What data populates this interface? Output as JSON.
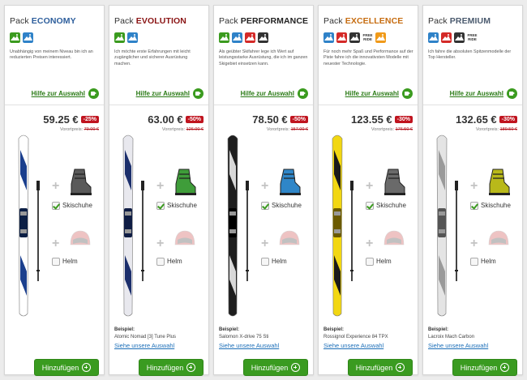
{
  "colors": {
    "green": "#3b9b1f",
    "red_badge": "#c0141f",
    "link_blue": "#1d6fb8"
  },
  "packs": [
    {
      "pack_word": "Pack",
      "name": "ECONOMY",
      "name_color": "#2d5e9c",
      "icons": [
        "green",
        "blue"
      ],
      "description": "Unabhängig von meinem Niveau bin ich an reduzierten Preisen interessiert.",
      "help_link": "Hilfe zur Auswahl",
      "price": "59.25 €",
      "discount": "-25%",
      "old_label": "Vorortpreis:",
      "old_price": "79.00 €",
      "ski_main": "#ffffff",
      "ski_accent": "#1b3f8d",
      "ski_dark": "#0c1f45",
      "boot_color": "#5a5a5a",
      "checkbox_boots": "Skischuhe",
      "checkbox_helmet": "Helm",
      "example_label": "",
      "example_name": "",
      "example_link": "",
      "add_button": "Hinzufügen"
    },
    {
      "pack_word": "Pack",
      "name": "EVOLUTION",
      "name_color": "#8a1414",
      "icons": [
        "green",
        "blue"
      ],
      "description": "Ich möchte erste Erfahrungen mit leicht zugänglicher und sicherer Ausrüstung machen.",
      "help_link": "Hilfe zur Auswahl",
      "price": "63.00 €",
      "discount": "-50%",
      "old_label": "Vorortpreis:",
      "old_price": "126.00 €",
      "ski_main": "#e8e8ee",
      "ski_accent": "#1c2f6c",
      "ski_dark": "#0f1d44",
      "boot_color": "#3f9d3a",
      "checkbox_boots": "Skischuhe",
      "checkbox_helmet": "Helm",
      "example_label": "Beispiel:",
      "example_name": "Atomic Nomad [3] Tune Plus",
      "example_link": "Siehe unsere Auswahl",
      "add_button": "Hinzufügen"
    },
    {
      "pack_word": "Pack",
      "name": "PERFORMANCE",
      "name_color": "#222222",
      "icons": [
        "green",
        "blue",
        "red",
        "black"
      ],
      "description": "Als geübter Skifahrer lege ich Wert auf leistungsstarke Ausrüstung, die ich im ganzen Skigebiet einsetzen kann.",
      "help_link": "Hilfe zur Auswahl",
      "price": "78.50 €",
      "discount": "-50%",
      "old_label": "Vorortpreis:",
      "old_price": "157.00 €",
      "ski_main": "#1e1e1e",
      "ski_accent": "#d8d8d8",
      "ski_dark": "#000000",
      "boot_color": "#2f86c8",
      "checkbox_boots": "Skischuhe",
      "checkbox_helmet": "Helm",
      "example_label": "Beispiel:",
      "example_name": "Salomon X-drive 75 Sti",
      "example_link": "Siehe unsere Auswahl",
      "add_button": "Hinzufügen"
    },
    {
      "pack_word": "Pack",
      "name": "EXCELLENCE",
      "name_color": "#c66c10",
      "icons": [
        "blue",
        "red",
        "black",
        "freeride",
        "orange"
      ],
      "description": "Für noch mehr Spaß und Performance auf der Piste fahre ich die innovativsten Modelle mit neuester Technologie.",
      "help_link": "Hilfe zur Auswahl",
      "price": "123.55 €",
      "discount": "-30%",
      "old_label": "Vorortpreis:",
      "old_price": "176.50 €",
      "ski_main": "#f2d712",
      "ski_accent": "#1a1a1a",
      "ski_dark": "#6b5a00",
      "boot_color": "#6a6a6a",
      "checkbox_boots": "Skischuhe",
      "checkbox_helmet": "Helm",
      "example_label": "Beispiel:",
      "example_name": "Rossignol Experience 84 TPX",
      "example_link": "Siehe unsere Auswahl",
      "add_button": "Hinzufügen"
    },
    {
      "pack_word": "Pack",
      "name": "PREMIUM",
      "name_color": "#4a5a6e",
      "icons": [
        "blue",
        "red",
        "black",
        "freeride"
      ],
      "description": "Ich fahre die absoluten Spitzenmodelle der Top Hersteller.",
      "help_link": "Hilfe zur Auswahl",
      "price": "132.65 €",
      "discount": "-30%",
      "old_label": "Vorortpreis:",
      "old_price": "189.50 €",
      "ski_main": "#e4e4e4",
      "ski_accent": "#9a9a9a",
      "ski_dark": "#555555",
      "boot_color": "#b9b91a",
      "checkbox_boots": "Skischuhe",
      "checkbox_helmet": "Helm",
      "example_label": "Beispiel:",
      "example_name": "Lacroix Mach Carbon",
      "example_link": "Siehe unsere Auswahl",
      "add_button": "Hinzufügen"
    }
  ],
  "freeride_text": "FREE RIDE"
}
